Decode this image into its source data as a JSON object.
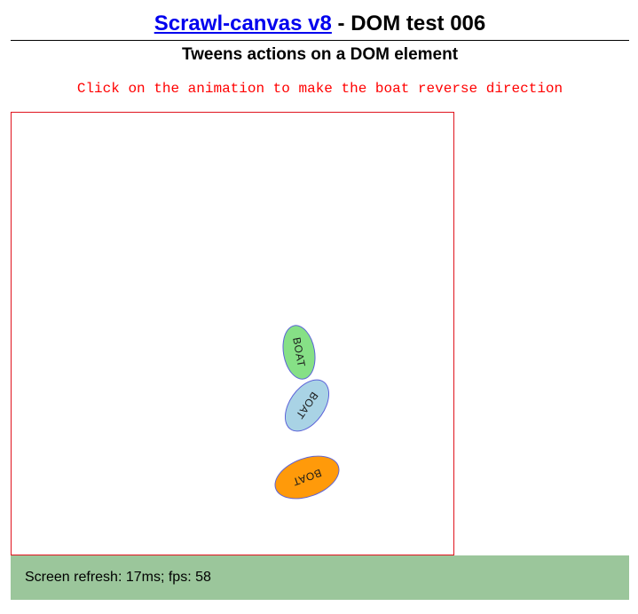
{
  "header": {
    "link_text": "Scrawl-canvas v8",
    "title_suffix": " - DOM test 006",
    "subtitle": "Tweens actions on a DOM element",
    "instruction": "Click on the animation to make the boat reverse direction"
  },
  "stage": {
    "border_color": "#e0141e",
    "boats": [
      {
        "label": "BOAT",
        "color": "#86e086"
      },
      {
        "label": "BOAT",
        "color": "#a9d3e5"
      },
      {
        "label": "BOAT",
        "color": "#ff9a0a"
      }
    ]
  },
  "status": {
    "text": "Screen refresh: 17ms; fps: 58",
    "background": "#9bc69b"
  }
}
